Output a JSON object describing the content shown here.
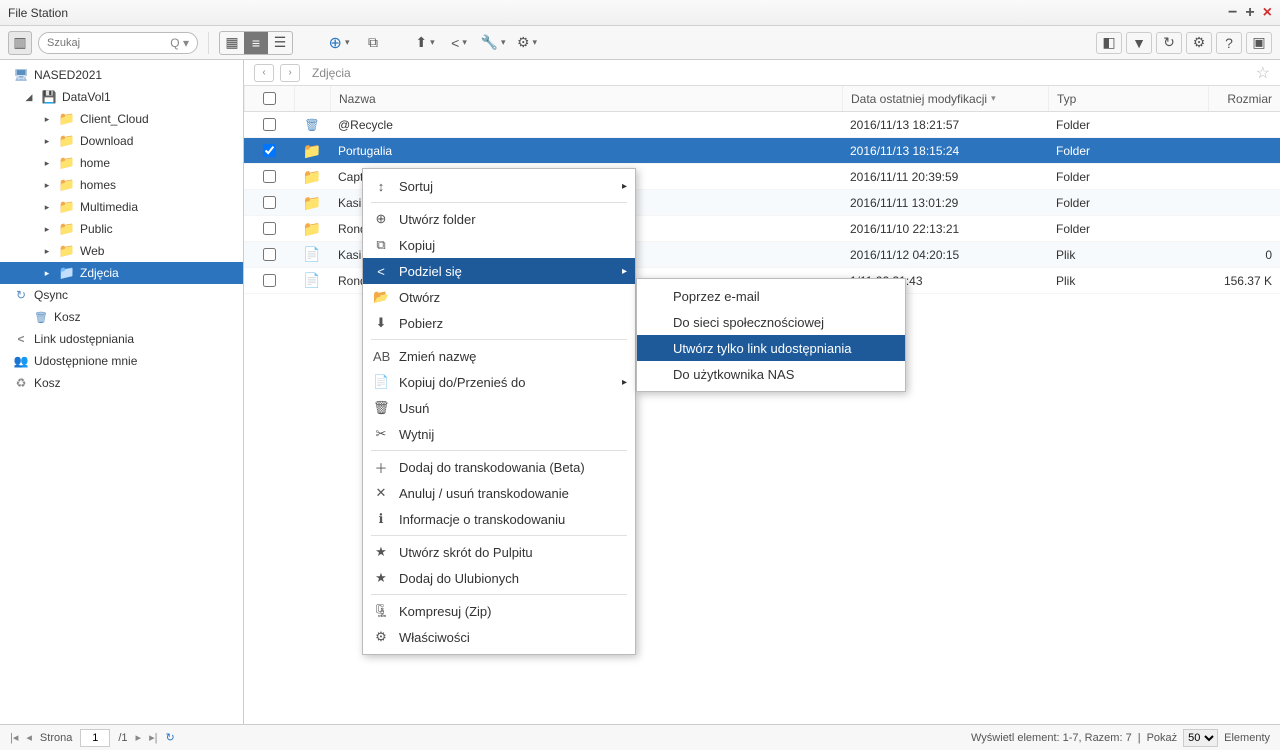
{
  "window": {
    "title": "File Station"
  },
  "toolbar": {
    "search_placeholder": "Szukaj"
  },
  "sidebar": {
    "root": "NASED2021",
    "volume": "DataVol1",
    "folders": [
      "Client_Cloud",
      "Download",
      "home",
      "homes",
      "Multimedia",
      "Public",
      "Web",
      "Zdjęcia"
    ],
    "qsync": "Qsync",
    "kosz": "Kosz",
    "link": "Link udostępniania",
    "shared": "Udostępnione mnie",
    "trash": "Kosz"
  },
  "breadcrumb": {
    "path": "Zdjęcia"
  },
  "table": {
    "headers": {
      "name": "Nazwa",
      "date": "Data ostatniej modyfikacji",
      "type": "Typ",
      "size": "Rozmiar"
    },
    "rows": [
      {
        "icon": "recycle",
        "name": "@Recycle",
        "date": "2016/11/13 18:21:57",
        "type": "Folder",
        "size": "",
        "sel": false
      },
      {
        "icon": "folder",
        "name": "Portugalia",
        "date": "2016/11/13 18:15:24",
        "type": "Folder",
        "size": "",
        "sel": true
      },
      {
        "icon": "folder",
        "name": "Captu",
        "date": "2016/11/11 20:39:59",
        "type": "Folder",
        "size": "",
        "sel": false
      },
      {
        "icon": "folder",
        "name": "Kasia",
        "date": "2016/11/11 13:01:29",
        "type": "Folder",
        "size": "",
        "sel": false
      },
      {
        "icon": "folder",
        "name": "Ronda",
        "date": "2016/11/10 22:13:21",
        "type": "Folder",
        "size": "",
        "sel": false
      },
      {
        "icon": "file",
        "name": "Kasia",
        "date": "2016/11/12 04:20:15",
        "type": "Plik",
        "size": "0",
        "sel": false
      },
      {
        "icon": "file",
        "name": "Ronda",
        "date": "1/11 22:31:43",
        "type": "Plik",
        "size": "156.37 K",
        "sel": false
      }
    ]
  },
  "ctx": {
    "sort": "Sortuj",
    "newfolder": "Utwórz folder",
    "copy": "Kopiuj",
    "share": "Podziel się",
    "open": "Otwórz",
    "download": "Pobierz",
    "rename": "Zmień nazwę",
    "copymove": "Kopiuj do/Przenieś do",
    "delete": "Usuń",
    "cut": "Wytnij",
    "transcode": "Dodaj do transkodowania (Beta)",
    "canceltc": "Anuluj / usuń transkodowanie",
    "infotc": "Informacje o transkodowaniu",
    "shortcut": "Utwórz skrót do Pulpitu",
    "fav": "Dodaj do Ulubionych",
    "zip": "Kompresuj (Zip)",
    "props": "Właściwości"
  },
  "sub": {
    "email": "Poprzez e-mail",
    "social": "Do sieci społecznościowej",
    "link": "Utwórz tylko link udostępniania",
    "nas": "Do użytkownika NAS"
  },
  "status": {
    "page_label": "Strona",
    "page": "1",
    "pages": "/1",
    "summary": "Wyświetl element: 1-7, Razem: 7",
    "show": "Pokaż",
    "show_val": "50",
    "items": "Elementy"
  }
}
